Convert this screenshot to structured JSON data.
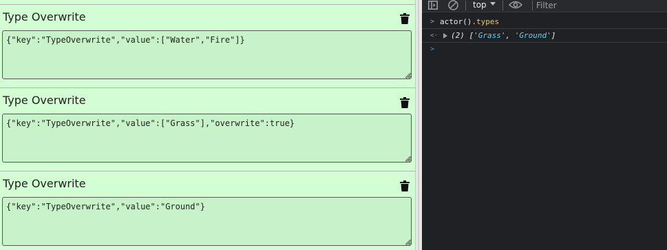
{
  "cards": [
    {
      "title": "Type Overwrite",
      "json": "{\"key\":\"TypeOverwrite\",\"value\":[\"Water\",\"Fire\"]}"
    },
    {
      "title": "Type Overwrite",
      "json": "{\"key\":\"TypeOverwrite\",\"value\":[\"Grass\"],\"overwrite\":true}"
    },
    {
      "title": "Type Overwrite",
      "json": "{\"key\":\"TypeOverwrite\",\"value\":\"Ground\"}"
    }
  ],
  "devtools": {
    "context": "top",
    "filter_placeholder": "Filter",
    "console": {
      "input_prompt": ">",
      "output_prompt": "<·",
      "command": "actor()",
      "command_prop": ".types",
      "result_count": "(2)",
      "result_open": "[",
      "result_items": [
        "'Grass'",
        "'Ground'"
      ],
      "result_sep": ", ",
      "result_close": "]",
      "prompt": ">"
    }
  },
  "colors": {
    "panel_bg": "#d3fdd3",
    "editor_bg": "#c8f2c8",
    "devtools_bg": "#202124",
    "string_value": "#5cd5fb",
    "prompt_blue": "#4d8df0"
  },
  "icons": {
    "card_delete": "trash-icon",
    "toolbar_sidebar": "sidebar-toggle-icon",
    "toolbar_clear": "clear-console-icon",
    "toolbar_live": "eye-icon"
  }
}
